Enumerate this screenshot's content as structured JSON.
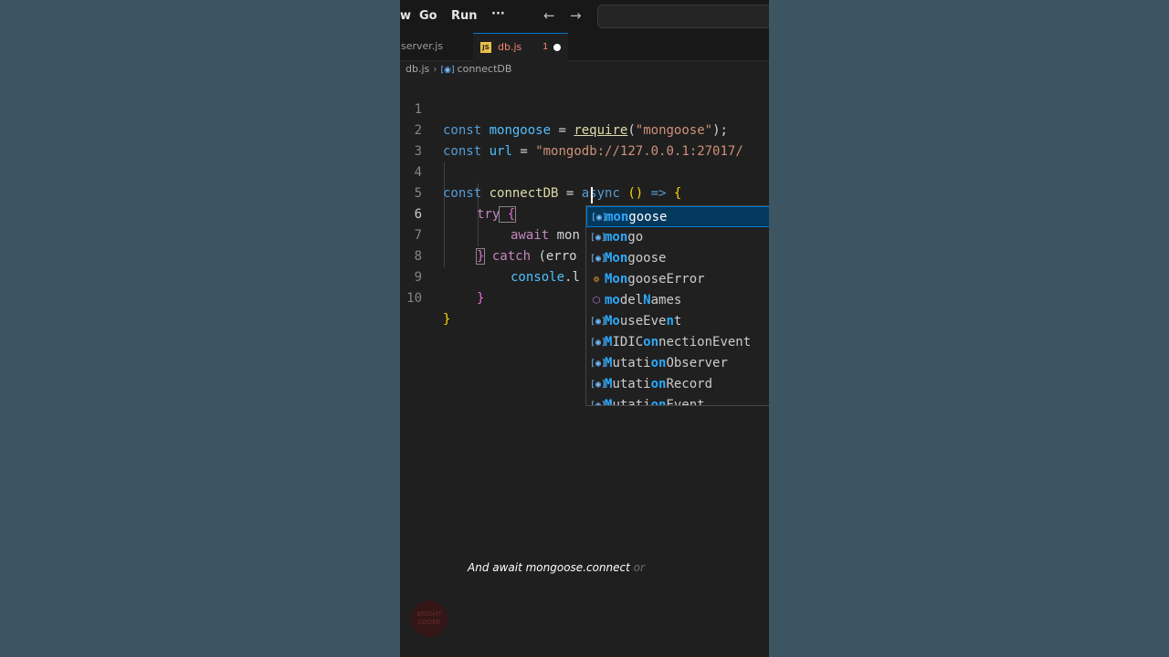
{
  "menu": {
    "view_partial": "w",
    "go": "Go",
    "run": "Run",
    "more": "···"
  },
  "nav": {
    "back": "←",
    "forward": "→"
  },
  "tabs": [
    {
      "label": "server.js",
      "active": false
    },
    {
      "label": "db.js",
      "active": true,
      "badge": "1",
      "modified": true
    }
  ],
  "breadcrumb": {
    "file": "db.js",
    "symbol": "connectDB"
  },
  "editor": {
    "line_numbers": [
      "1",
      "2",
      "3",
      "4",
      "5",
      "6",
      "7",
      "8",
      "9",
      "10"
    ],
    "current_line": "6",
    "lines": {
      "l1": {
        "a": "const",
        "b": "mongoose",
        "c": " = ",
        "d": "require",
        "e": "(",
        "f": "\"mongoose\"",
        "g": ");"
      },
      "l2": {
        "a": "const",
        "b": "url",
        "c": " = ",
        "d": "\"mongodb://127.0.0.1:27017/"
      },
      "l4": {
        "a": "const",
        "b": "connectDB",
        "c": " = ",
        "d": "async",
        "e": " () ",
        "f": "=>",
        "g": " {"
      },
      "l5": {
        "a": "try",
        "b": " {"
      },
      "l6": {
        "a": "await",
        "b": " mon"
      },
      "l7": {
        "a": "}",
        "b": " catch",
        "c": " (erro"
      },
      "l8": {
        "a": "console",
        "b": ".l"
      },
      "l9": {
        "a": "}"
      },
      "l10": {
        "a": "}"
      }
    }
  },
  "suggestions": [
    {
      "kind": "variable",
      "pre": "",
      "m1": "mon",
      "rest": "goose",
      "selected": true
    },
    {
      "kind": "variable",
      "pre": "",
      "m1": "mon",
      "rest": "go"
    },
    {
      "kind": "variable",
      "pre": "",
      "m1": "Mon",
      "rest": "goose"
    },
    {
      "kind": "class",
      "pre": "",
      "m1": "Mon",
      "rest": "gooseError"
    },
    {
      "kind": "module",
      "pre": "",
      "m1": "mo",
      "rest": "del",
      "m2": "N",
      "rest2": "ames"
    },
    {
      "kind": "variable",
      "pre": "",
      "m1": "Mo",
      "rest": "useEve",
      "m2": "n",
      "rest2": "t"
    },
    {
      "kind": "variable",
      "pre": "",
      "m1": "M",
      "rest": "IDIC",
      "m2": "on",
      "rest2": "nectionEvent"
    },
    {
      "kind": "variable",
      "pre": "",
      "m1": "M",
      "rest": "utati",
      "m2": "on",
      "rest2": "Observer"
    },
    {
      "kind": "variable",
      "pre": "",
      "m1": "M",
      "rest": "utati",
      "m2": "on",
      "rest2": "Record"
    },
    {
      "kind": "variable",
      "pre": "",
      "m1": "M",
      "rest": "utati",
      "m2": "on",
      "rest2": "Event"
    }
  ],
  "caption": {
    "text": "And await mongoose.connect",
    "faded": "or"
  },
  "watermark": "BRIGHT CODER",
  "colors": {
    "accent": "#0078d4",
    "selection": "#04395e",
    "keyword": "#569cd6",
    "string": "#ce9178"
  }
}
